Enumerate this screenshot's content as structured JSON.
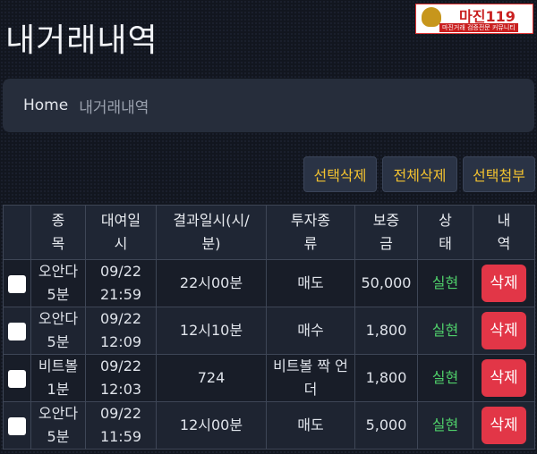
{
  "page": {
    "title": "내거래내역"
  },
  "logo": {
    "brand": "마진119",
    "tagline": "마진거래 검증전문 커뮤니티"
  },
  "breadcrumb": {
    "home": "Home",
    "current": "내거래내역"
  },
  "actions": {
    "delete_selected": "선택삭제",
    "delete_all": "전체삭제",
    "attach_selected": "선택첨부"
  },
  "table": {
    "headers": {
      "item": "종\n목",
      "placed": "대여일\n시",
      "result_time": "결과일시(시/\n분)",
      "type": "투자종\n류",
      "deposit": "보증\n금",
      "status": "상\n태",
      "action": "내\n역"
    },
    "rows": [
      {
        "item": "오안다\n5분",
        "placed": "09/22\n21:59",
        "result_time": "22시00분",
        "type": "매도",
        "deposit": "50,000",
        "status": "실현",
        "action": "삭제"
      },
      {
        "item": "오안다\n5분",
        "placed": "09/22\n12:09",
        "result_time": "12시10분",
        "type": "매수",
        "deposit": "1,800",
        "status": "실현",
        "action": "삭제"
      },
      {
        "item": "비트볼\n1분",
        "placed": "09/22\n12:03",
        "result_time": "724",
        "type": "비트볼 짝 언\n더",
        "deposit": "1,800",
        "status": "실현",
        "action": "삭제"
      },
      {
        "item": "오안다\n5분",
        "placed": "09/22\n11:59",
        "result_time": "12시00분",
        "type": "매도",
        "deposit": "5,000",
        "status": "실현",
        "action": "삭제"
      }
    ]
  },
  "colors": {
    "accent_yellow": "#f2c230",
    "status_green": "#4fcf6a",
    "delete_red": "#e23647"
  }
}
